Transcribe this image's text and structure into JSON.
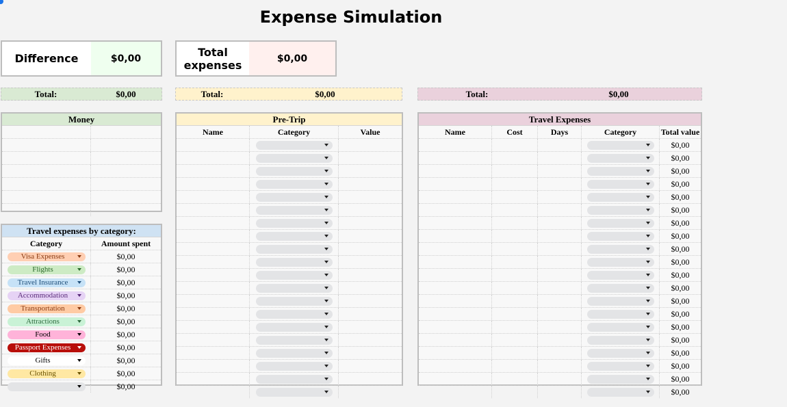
{
  "page_title": "Expense Simulation",
  "cards": {
    "difference": {
      "label": "Difference",
      "value": "$0,00"
    },
    "total_expenses": {
      "label": "Total\nexpenses",
      "value": "$0,00"
    }
  },
  "totals": {
    "money": {
      "label": "Total:",
      "value": "$0,00"
    },
    "pre_trip": {
      "label": "Total:",
      "value": "$0,00"
    },
    "travel": {
      "label": "Total:",
      "value": "$0,00"
    }
  },
  "money_table": {
    "title": "Money",
    "rows": 7
  },
  "by_category": {
    "title": "Travel expenses by category:",
    "columns": [
      "Category",
      "Amount spent"
    ],
    "rows": [
      {
        "category": "Visa Expenses",
        "amount": "$0,00",
        "bg": "#ffcfb3",
        "fg": "#8a3b12"
      },
      {
        "category": "Flights",
        "amount": "$0,00",
        "bg": "#cdebc4",
        "fg": "#2e6b2e"
      },
      {
        "category": "Travel Insurance",
        "amount": "$0,00",
        "bg": "#c6e2f7",
        "fg": "#1f4f7a"
      },
      {
        "category": "Accommodation",
        "amount": "$0,00",
        "bg": "#e6d3f5",
        "fg": "#5a2b7a"
      },
      {
        "category": "Transportation",
        "amount": "$0,00",
        "bg": "#ffcba4",
        "fg": "#8a3b12"
      },
      {
        "category": "Attractions",
        "amount": "$0,00",
        "bg": "#c9f2d6",
        "fg": "#2e6b3e"
      },
      {
        "category": "Food",
        "amount": "$0,00",
        "bg": "#ffb3d9",
        "fg": "#000000"
      },
      {
        "category": "Passport Expenses",
        "amount": "$0,00",
        "bg": "#b80f0a",
        "fg": "#ffffff"
      },
      {
        "category": "Gifts",
        "amount": "$0,00",
        "bg": "#ffffff",
        "fg": "#000000"
      },
      {
        "category": "Clothing",
        "amount": "$0,00",
        "bg": "#ffe8a3",
        "fg": "#6b5300"
      },
      {
        "category": "",
        "amount": "$0,00",
        "bg": "#e3e4e6",
        "fg": "#000000"
      }
    ]
  },
  "pre_trip": {
    "title": "Pre-Trip",
    "columns": [
      "Name",
      "Category",
      "Value"
    ],
    "rows": 20
  },
  "travel_expenses": {
    "title": "Travel Expenses",
    "columns": [
      "Name",
      "Cost",
      "Days",
      "Category",
      "Total value"
    ],
    "row_value": "$0,00",
    "rows": 20
  },
  "colors": {
    "money_green": "#d9ead3",
    "pre_trip_yellow": "#fff2cc",
    "travel_pink": "#ead1dc",
    "category_blue": "#cfe2f3",
    "difference_green": "#efffef",
    "expenses_pink": "#fff0ee"
  }
}
